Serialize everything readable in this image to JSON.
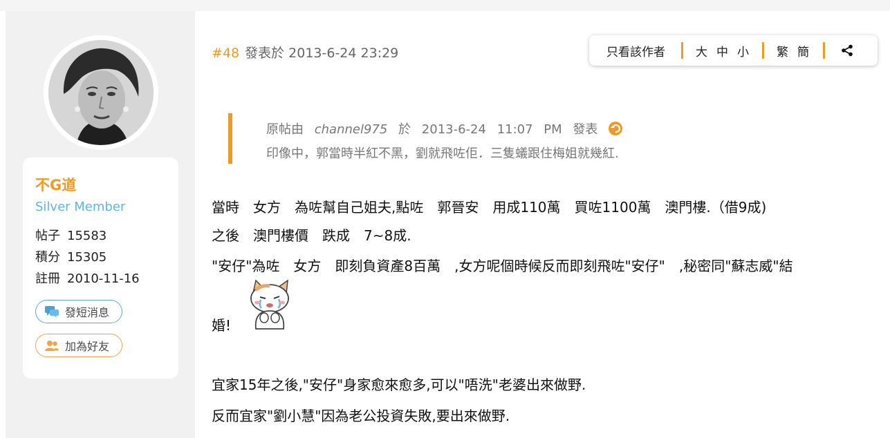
{
  "user": {
    "name": "不G道",
    "group": "Silver Member",
    "stats": [
      {
        "label": "帖子",
        "value": "15583"
      },
      {
        "label": "積分",
        "value": "15305"
      },
      {
        "label": "註冊",
        "value": "2010-11-16"
      }
    ],
    "send_message_label": "發短消息",
    "add_friend_label": "加為好友"
  },
  "post": {
    "number": "#48",
    "posted_label": "發表於 2013-6-24 23:29"
  },
  "toolbar": {
    "author_only": "只看該作者",
    "size_large": "大",
    "size_medium": "中",
    "size_small": "小",
    "trad": "繁",
    "simp": "簡"
  },
  "quote": {
    "prefix": "原帖由",
    "author": "channel975",
    "on": "於",
    "date": "2013-6-24",
    "time": "11:07",
    "ampm": "PM",
    "posted": "發表",
    "text": "印像中，郭當時半紅不黑，劉就飛咗佢．三隻蟻跟住梅姐就幾紅."
  },
  "body": {
    "line1": "當時　女方　為咗幫自己姐夫,點咗　郭晉安　用成110萬　買咗1100萬　澳門樓.（借9成)",
    "line2": "之後　澳門樓價　跌成　7~8成.",
    "line3": "\"安仔\"為咗　女方　即刻負資產8百萬　,女方呢個時候反而即刻飛咗\"安仔\"　,秘密同\"蘇志威\"結",
    "line4": "婚!",
    "line5": "宜家15年之後,\"安仔\"身家愈來愈多,可以\"唔洗\"老婆出來做野.",
    "line6": "反而宜家\"劉小慧\"因為老公投資失敗,要出來做野."
  },
  "colors": {
    "accent_orange": "#f09a26",
    "link_blue": "#5bb6e6",
    "sidebar_bg": "#f1f1f1"
  },
  "icons": {
    "message": "chat-bubble-icon",
    "friend": "users-icon",
    "share": "share-icon",
    "back": "back-arrow-icon",
    "emoji": "crying-cat-emoji"
  }
}
